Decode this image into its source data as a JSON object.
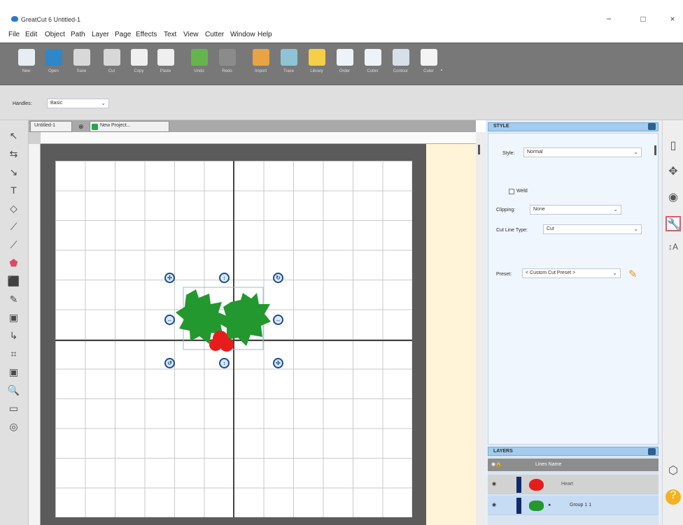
{
  "window": {
    "title": "GreatCut 6 Untitled-1",
    "minimize": "−",
    "maximize": "□",
    "close": "×"
  },
  "menu": [
    "File",
    "Edit",
    "Object",
    "Path",
    "Layer",
    "Page",
    "Effects",
    "Text",
    "View",
    "Cutter",
    "Window",
    "Help"
  ],
  "toolbar": {
    "items": [
      {
        "label": "New",
        "icon": "new-document-icon"
      },
      {
        "label": "Open",
        "icon": "open-folder-icon"
      },
      {
        "label": "Save",
        "icon": "save-disk-icon"
      },
      {
        "label": "Cut",
        "icon": "cut-icon"
      },
      {
        "label": "Copy",
        "icon": "copy-icon"
      },
      {
        "label": "Paste",
        "icon": "paste-icon"
      },
      {
        "label": "Undo",
        "icon": "undo-icon"
      },
      {
        "label": "Redo",
        "icon": "redo-icon"
      },
      {
        "label": "Import",
        "icon": "import-icon"
      },
      {
        "label": "Trace",
        "icon": "trace-icon"
      },
      {
        "label": "Library",
        "icon": "library-icon"
      },
      {
        "label": "Order",
        "icon": "order-icon"
      },
      {
        "label": "Cutter",
        "icon": "cutter-icon"
      },
      {
        "label": "Contour",
        "icon": "contour-icon"
      },
      {
        "label": "Cuter",
        "icon": "pen-cutter-icon"
      }
    ],
    "extra": "."
  },
  "properties": {
    "handles_label": "Handles:",
    "handles_value": "Basic"
  },
  "tabs": [
    {
      "label": "Untitled-1"
    },
    {
      "label": "New Project..."
    }
  ],
  "style_panel": {
    "title": "STYLE",
    "style_label": "Style:",
    "style_value": "Normal",
    "weld_label": "Weld",
    "clipping_label": "Clipping:",
    "clipping_value": "None",
    "cutline_label": "Cut Line Type:",
    "cutline_value": "Cut",
    "preset_label": "Preset:",
    "preset_value": "< Custom Cut Preset >"
  },
  "layers_panel": {
    "title": "LAYERS",
    "header_label": "Lines Name",
    "rows": [
      {
        "name": "Heart"
      },
      {
        "name": "Group 1 1"
      }
    ]
  },
  "right_tools": [
    "page-icon",
    "move-icon",
    "color-wheel-icon",
    "wrench-icon",
    "text-size-icon"
  ],
  "colors": {
    "holly_green": "#22982e",
    "berry_red": "#e71c1c",
    "selection_blue": "#1a4d8f"
  }
}
